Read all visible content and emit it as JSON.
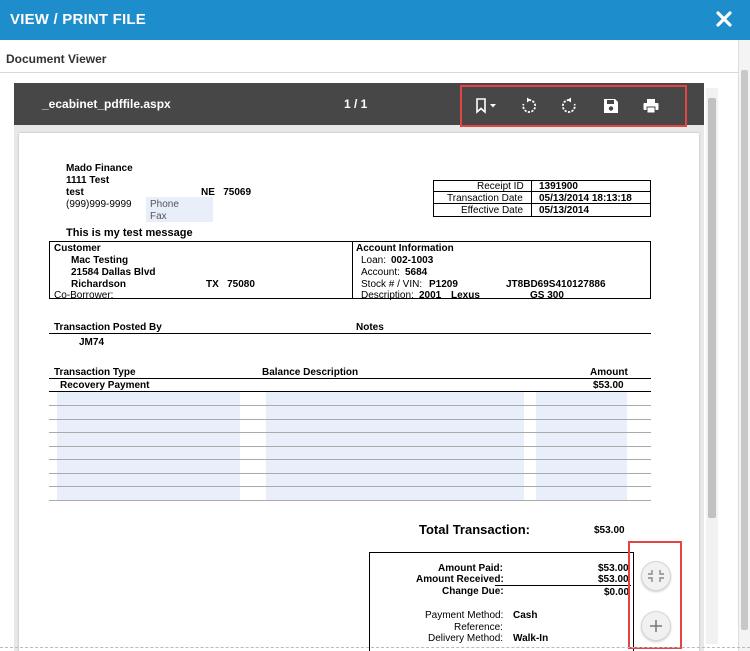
{
  "dialog": {
    "title": "VIEW / PRINT FILE"
  },
  "panel": {
    "label": "Document Viewer"
  },
  "viewer": {
    "file_name": "_ecabinet_pdffile.aspx",
    "page_indicator": "1 / 1"
  },
  "icons": {
    "close": "close-icon",
    "bookmark": "bookmark-icon",
    "rotate_cw": "rotate-clockwise-icon",
    "rotate_ccw": "rotate-counterclockwise-icon",
    "save": "save-icon",
    "print": "print-icon",
    "collapse": "collapse-icon",
    "zoom_in": "plus-icon"
  },
  "colors": {
    "title_bar": "#1e8dcb",
    "toolbar": "#474747",
    "highlight_box": "#e34545"
  },
  "receipt": {
    "company": {
      "name": "Mado Finance",
      "address": "1111 Test",
      "city": "test",
      "state_zip": "NE   75069",
      "phone_number": "(999)999-9999",
      "phone_label": "Phone",
      "fax_label": "Fax"
    },
    "info": [
      {
        "label": "Receipt ID",
        "value": "1391900"
      },
      {
        "label": "Transaction Date",
        "value": "05/13/2014 18:13:18"
      },
      {
        "label": "Effective Date",
        "value": "05/13/2014"
      }
    ],
    "message": "This is my test message",
    "customer": {
      "header": "Customer",
      "name": "Mac Testing",
      "address": "21584 Dallas Blvd",
      "city": "Richardson",
      "state_zip": "TX   75080",
      "coborrower_label": "Co-Borrower:"
    },
    "account": {
      "header": "Account Information",
      "loan_label": "Loan:",
      "loan": "002-1003",
      "account_label": "Account:",
      "account": "5684",
      "stock_label": "Stock # / VIN:",
      "stock": "P1209",
      "vin": "JT8BD69S410127886",
      "description_label": "Description:",
      "year": "2001",
      "make": "Lexus",
      "model": "GS 300"
    },
    "posted_by_header": "Transaction Posted By",
    "posted_by": "JM74",
    "notes_header": "Notes",
    "table": {
      "headers": [
        "Transaction Type",
        "Balance Description",
        "Amount"
      ],
      "rows": [
        {
          "type": "Recovery Payment",
          "description": "",
          "amount": "$53.00"
        }
      ]
    },
    "total_label": "Total Transaction:",
    "total": "$53.00",
    "summary": {
      "amount_paid_label": "Amount Paid:",
      "amount_paid": "$53.00",
      "amount_received_label": "Amount Received:",
      "amount_received": "$53.00",
      "change_due_label": "Change Due:",
      "change_due": "$0.00",
      "payment_method_label": "Payment Method:",
      "payment_method": "Cash",
      "reference_label": "Reference:",
      "reference": "",
      "delivery_method_label": "Delivery Method:",
      "delivery_method": "Walk-In"
    }
  }
}
